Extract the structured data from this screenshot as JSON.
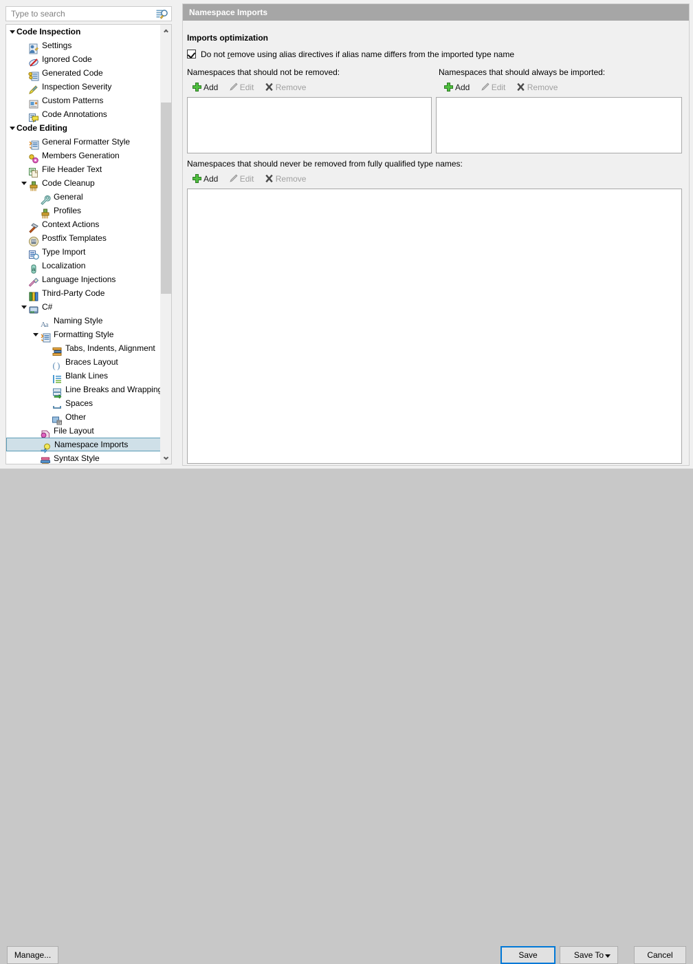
{
  "search": {
    "placeholder": "Type to search",
    "value": "",
    "icon": "search-icon"
  },
  "tree": {
    "items": [
      {
        "label": "Code Inspection",
        "depth": 0,
        "group": true,
        "expanded": true,
        "icon": "none",
        "selected": false
      },
      {
        "label": "Settings",
        "depth": 1,
        "group": false,
        "expanded": null,
        "icon": "settings-person-icon",
        "selected": false
      },
      {
        "label": "Ignored Code",
        "depth": 1,
        "group": false,
        "expanded": null,
        "icon": "ignored-code-icon",
        "selected": false
      },
      {
        "label": "Generated Code",
        "depth": 1,
        "group": false,
        "expanded": null,
        "icon": "generated-code-icon",
        "selected": false
      },
      {
        "label": "Inspection Severity",
        "depth": 1,
        "group": false,
        "expanded": null,
        "icon": "severity-icon",
        "selected": false
      },
      {
        "label": "Custom Patterns",
        "depth": 1,
        "group": false,
        "expanded": null,
        "icon": "custom-patterns-icon",
        "selected": false
      },
      {
        "label": "Code Annotations",
        "depth": 1,
        "group": false,
        "expanded": null,
        "icon": "annotations-icon",
        "selected": false
      },
      {
        "label": "Code Editing",
        "depth": 0,
        "group": true,
        "expanded": true,
        "icon": "none",
        "selected": false
      },
      {
        "label": "General Formatter Style",
        "depth": 1,
        "group": false,
        "expanded": null,
        "icon": "formatter-icon",
        "selected": false
      },
      {
        "label": "Members Generation",
        "depth": 1,
        "group": false,
        "expanded": null,
        "icon": "members-gen-icon",
        "selected": false
      },
      {
        "label": "File Header Text",
        "depth": 1,
        "group": false,
        "expanded": null,
        "icon": "file-header-icon",
        "selected": false
      },
      {
        "label": "Code Cleanup",
        "depth": 1,
        "group": false,
        "expanded": true,
        "icon": "cleanup-icon",
        "selected": false
      },
      {
        "label": "General",
        "depth": 2,
        "group": false,
        "expanded": null,
        "icon": "wrench-icon",
        "selected": false
      },
      {
        "label": "Profiles",
        "depth": 2,
        "group": false,
        "expanded": null,
        "icon": "cleanup-icon",
        "selected": false
      },
      {
        "label": "Context Actions",
        "depth": 1,
        "group": false,
        "expanded": null,
        "icon": "hammer-icon",
        "selected": false
      },
      {
        "label": "Postfix Templates",
        "depth": 1,
        "group": false,
        "expanded": null,
        "icon": "postfix-icon",
        "selected": false
      },
      {
        "label": "Type Import",
        "depth": 1,
        "group": false,
        "expanded": null,
        "icon": "type-import-icon",
        "selected": false
      },
      {
        "label": "Localization",
        "depth": 1,
        "group": false,
        "expanded": null,
        "icon": "localization-icon",
        "selected": false
      },
      {
        "label": "Language Injections",
        "depth": 1,
        "group": false,
        "expanded": null,
        "icon": "injection-icon",
        "selected": false
      },
      {
        "label": "Third-Party Code",
        "depth": 1,
        "group": false,
        "expanded": null,
        "icon": "third-party-icon",
        "selected": false
      },
      {
        "label": "C#",
        "depth": 1,
        "group": false,
        "expanded": true,
        "icon": "csharp-icon",
        "selected": false
      },
      {
        "label": "Naming Style",
        "depth": 2,
        "group": false,
        "expanded": null,
        "icon": "naming-style-icon",
        "selected": false
      },
      {
        "label": "Formatting Style",
        "depth": 2,
        "group": false,
        "expanded": true,
        "icon": "formatter-icon",
        "selected": false
      },
      {
        "label": "Tabs, Indents, Alignment",
        "depth": 3,
        "group": false,
        "expanded": null,
        "icon": "tabs-indents-icon",
        "selected": false
      },
      {
        "label": "Braces Layout",
        "depth": 3,
        "group": false,
        "expanded": null,
        "icon": "braces-icon",
        "selected": false
      },
      {
        "label": "Blank Lines",
        "depth": 3,
        "group": false,
        "expanded": null,
        "icon": "blank-lines-icon",
        "selected": false
      },
      {
        "label": "Line Breaks and Wrapping",
        "depth": 3,
        "group": false,
        "expanded": null,
        "icon": "line-breaks-icon",
        "selected": false
      },
      {
        "label": "Spaces",
        "depth": 3,
        "group": false,
        "expanded": null,
        "icon": "spaces-icon",
        "selected": false
      },
      {
        "label": "Other",
        "depth": 3,
        "group": false,
        "expanded": null,
        "icon": "other-icon",
        "selected": false
      },
      {
        "label": "File Layout",
        "depth": 2,
        "group": false,
        "expanded": null,
        "icon": "file-layout-icon",
        "selected": false
      },
      {
        "label": "Namespace Imports",
        "depth": 2,
        "group": false,
        "expanded": null,
        "icon": "namespace-imports-icon",
        "selected": true
      },
      {
        "label": "Syntax Style",
        "depth": 2,
        "group": false,
        "expanded": null,
        "icon": "syntax-style-icon",
        "selected": false
      }
    ]
  },
  "panel": {
    "header": "Namespace Imports",
    "section_title": "Imports optimization",
    "checkbox": {
      "checked": true,
      "text_before": "Do not ",
      "accesskey": "r",
      "text_after": "emove using alias directives if alias name differs from the imported type name"
    },
    "groups": [
      {
        "label": "Namespaces that should not be removed:",
        "toolbar": [
          {
            "label": "Add",
            "icon": "plus-icon",
            "enabled": true
          },
          {
            "label": "Edit",
            "icon": "pencil-icon",
            "enabled": false
          },
          {
            "label": "Remove",
            "icon": "x-icon",
            "enabled": false
          }
        ],
        "list_items": []
      },
      {
        "label": "Namespaces that should always be imported:",
        "toolbar": [
          {
            "label": "Add",
            "icon": "plus-icon",
            "enabled": true
          },
          {
            "label": "Edit",
            "icon": "pencil-icon",
            "enabled": false
          },
          {
            "label": "Remove",
            "icon": "x-icon",
            "enabled": false
          }
        ],
        "list_items": []
      },
      {
        "label": "Namespaces that should never be removed from fully qualified type names:",
        "toolbar": [
          {
            "label": "Add",
            "icon": "plus-icon",
            "enabled": true
          },
          {
            "label": "Edit",
            "icon": "pencil-icon",
            "enabled": false
          },
          {
            "label": "Remove",
            "icon": "x-icon",
            "enabled": false
          }
        ],
        "list_items": []
      }
    ]
  },
  "footer": {
    "manage": "Manage...",
    "save": "Save",
    "save_to": "Save To",
    "cancel": "Cancel"
  },
  "colors": {
    "header_bar": "#a6a6a6",
    "window_bg": "#f0f0f0",
    "bottom_bg": "#c8c8c8",
    "selection_bg": "#cfe0e8",
    "selection_border": "#5a9ab5",
    "focus_border": "#0078d7",
    "add_green": "#3cb034",
    "disabled_text": "#a0a0a0"
  }
}
